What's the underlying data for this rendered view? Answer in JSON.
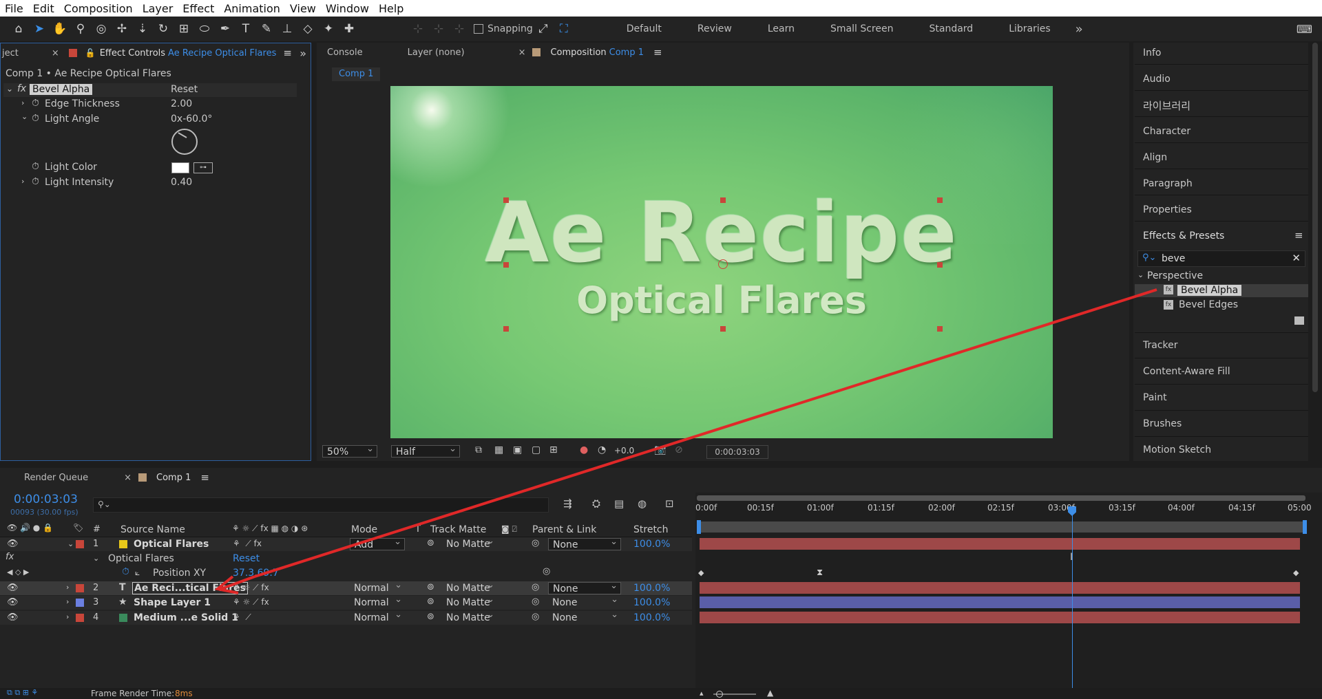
{
  "menu": [
    "File",
    "Edit",
    "Composition",
    "Layer",
    "Effect",
    "Animation",
    "View",
    "Window",
    "Help"
  ],
  "toolbar": {
    "snapping_label": "Snapping",
    "workspaces": [
      "Default",
      "Review",
      "Learn",
      "Small Screen",
      "Standard",
      "Libraries"
    ],
    "more": "»"
  },
  "effect_panel": {
    "left_tab": "ject",
    "tab_label": "Effect Controls",
    "tab_target": "Ae Recipe Optical Flares",
    "subtitle": "Comp 1 • Ae Recipe Optical Flares",
    "effect_name": "Bevel Alpha",
    "reset": "Reset",
    "props": [
      {
        "name": "Edge Thickness",
        "value": "2.00"
      },
      {
        "name": "Light Angle",
        "value": "0x-60.0°"
      },
      {
        "name": "Light Color",
        "value": ""
      },
      {
        "name": "Light Intensity",
        "value": "0.40"
      }
    ]
  },
  "viewer": {
    "tabs": [
      {
        "label": "Console"
      },
      {
        "label": "Layer (none)"
      },
      {
        "label": "Composition",
        "target": "Comp 1"
      }
    ],
    "breadcrumb": "Comp 1",
    "title_text": "Ae Recipe",
    "subtitle_text": "Optical Flares",
    "zoom": "50%",
    "resolution": "Half",
    "exposure": "+0.0",
    "timecode": "0:00:03:03"
  },
  "right_panel": {
    "items_top": [
      "Info",
      "Audio",
      "라이브러리",
      "Character",
      "Align",
      "Paragraph",
      "Properties"
    ],
    "effects_title": "Effects & Presets",
    "search_value": "beve",
    "folder": "Perspective",
    "results": [
      "Bevel Alpha",
      "Bevel Edges"
    ],
    "items_bottom": [
      "Tracker",
      "Content-Aware Fill",
      "Paint",
      "Brushes",
      "Motion Sketch"
    ]
  },
  "timeline": {
    "tabs": [
      "Render Queue",
      "Comp 1"
    ],
    "timecode": "0:00:03:03",
    "frame_info": "00093 (30.00 fps)",
    "columns": {
      "num": "#",
      "source": "Source Name",
      "mode": "Mode",
      "t": "T",
      "track_matte": "Track Matte",
      "parent": "Parent & Link",
      "stretch": "Stretch"
    },
    "ruler": [
      "0:00f",
      "00:15f",
      "01:00f",
      "01:15f",
      "02:00f",
      "02:15f",
      "03:00f",
      "03:15f",
      "04:00f",
      "04:15f",
      "05:00"
    ],
    "layers": [
      {
        "num": "1",
        "name": "Optical Flares",
        "color": "#e8c81a",
        "mode": "Add",
        "matte": "No Matte",
        "parent": "None",
        "stretch": "100.0%",
        "bar": "#9e4848"
      },
      {
        "num": "2",
        "name": "Ae Reci...tical Flares",
        "color": "#c8463a",
        "mode": "Normal",
        "matte": "No Matte",
        "parent": "None",
        "stretch": "100.0%",
        "bar": "#9e4848"
      },
      {
        "num": "3",
        "name": "Shape Layer 1",
        "color": "#6b7fe0",
        "mode": "Normal",
        "matte": "No Matte",
        "parent": "None",
        "stretch": "100.0%",
        "bar": "#5a5ea8"
      },
      {
        "num": "4",
        "name": "Medium ...e Solid 1",
        "color": "#3a8a5c",
        "mode": "Normal",
        "matte": "No Matte",
        "parent": "None",
        "stretch": "100.0%",
        "bar": "#9e4848"
      }
    ],
    "effect_group": "Optical Flares",
    "effect_reset": "Reset",
    "prop_name": "Position XY",
    "prop_value": "37.3,69.7",
    "fx_label": "fx",
    "render_time_label": "Frame Render Time:",
    "render_time_value": "8ms"
  },
  "colors": {
    "accent": "#3d8ee8",
    "annotation": "#e02828"
  }
}
